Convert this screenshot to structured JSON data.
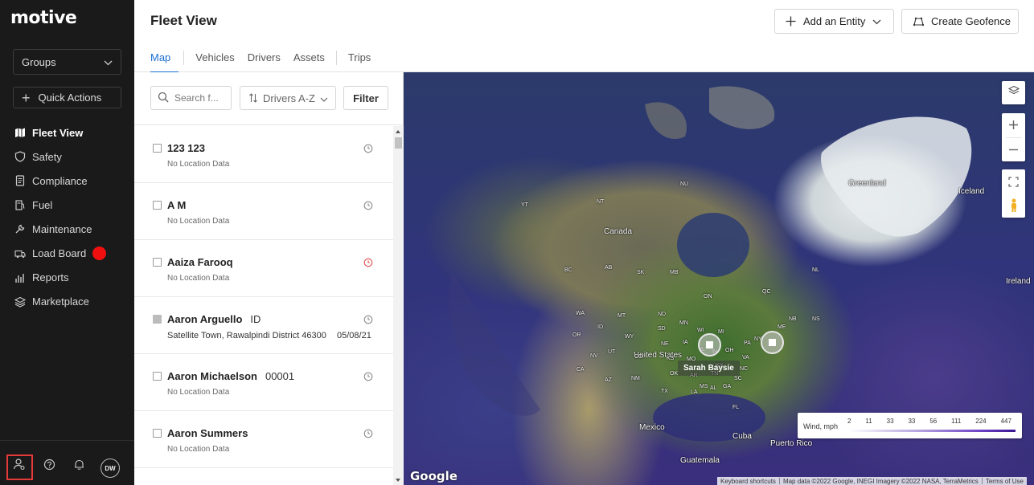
{
  "sidebar": {
    "logo": "motive",
    "groups_label": "Groups",
    "quick_actions_label": "Quick Actions",
    "items": [
      {
        "label": "Fleet View",
        "icon": "map-icon",
        "active": true
      },
      {
        "label": "Safety",
        "icon": "shield-icon"
      },
      {
        "label": "Compliance",
        "icon": "document-icon"
      },
      {
        "label": "Fuel",
        "icon": "fuel-pump-icon"
      },
      {
        "label": "Maintenance",
        "icon": "wrench-icon"
      },
      {
        "label": "Load Board",
        "icon": "truck-icon",
        "badge_color": "#f00f0f"
      },
      {
        "label": "Reports",
        "icon": "bar-chart-icon"
      },
      {
        "label": "Marketplace",
        "icon": "layers-icon"
      }
    ],
    "avatar_initials": "DW"
  },
  "header": {
    "title": "Fleet View",
    "add_entity_label": "Add an Entity",
    "create_geofence_label": "Create Geofence",
    "tabs": [
      {
        "label": "Map",
        "active": true
      },
      {
        "label": "Vehicles"
      },
      {
        "label": "Drivers"
      },
      {
        "label": "Assets"
      },
      {
        "label": "Trips"
      }
    ]
  },
  "list_panel": {
    "search_placeholder": "Search f...",
    "sort_label": "Drivers A-Z",
    "filter_label": "Filter",
    "rows": [
      {
        "name": "123 123",
        "tag": "",
        "location": "No Location Data",
        "date": "",
        "clock_color": "#8a8a8a"
      },
      {
        "name": "A M",
        "tag": "",
        "location": "No Location Data",
        "date": "",
        "clock_color": "#8a8a8a"
      },
      {
        "name": "Aaiza Farooq",
        "tag": "",
        "location": "No Location Data",
        "date": "",
        "clock_color": "#e05050"
      },
      {
        "name": "Aaron Arguello",
        "tag": "ID",
        "location": "Satellite Town, Rawalpindi District 46300",
        "date": "05/08/21",
        "clock_color": "#8a8a8a"
      },
      {
        "name": "Aaron Michaelson",
        "tag": "00001",
        "location": "No Location Data",
        "date": "",
        "clock_color": "#8a8a8a"
      },
      {
        "name": "Aaron Summers",
        "tag": "",
        "location": "No Location Data",
        "date": "",
        "clock_color": "#8a8a8a"
      }
    ]
  },
  "map": {
    "labels": {
      "greenland": "Greenland",
      "iceland": "Iceland",
      "ireland": "Ireland",
      "canada": "Canada",
      "united_states": "United States",
      "mexico": "Mexico",
      "cuba": "Cuba",
      "puerto_rico": "Puerto Rico",
      "guatemala": "Guatemala",
      "yt": "YT",
      "nt": "NT",
      "nu": "NU",
      "bc": "BC",
      "ab": "AB",
      "sk": "SK",
      "mb": "MB",
      "on": "ON",
      "qc": "QC",
      "nl": "NL",
      "nb": "NB",
      "ns": "NS",
      "me": "ME",
      "ny": "NY",
      "wa": "WA",
      "or": "OR",
      "ca": "CA",
      "nv": "NV",
      "id": "ID",
      "mt": "MT",
      "wy": "WY",
      "ut": "UT",
      "az": "AZ",
      "nm": "NM",
      "co": "CO",
      "nd": "ND",
      "sd": "SD",
      "ne": "NE",
      "ks": "KS",
      "ok": "OK",
      "tx": "TX",
      "mn": "MN",
      "ia": "IA",
      "mo": "MO",
      "ar": "AR",
      "la": "LA",
      "wi": "WI",
      "il": "IL",
      "in": "IN",
      "ky": "KY",
      "tn": "TN",
      "ms": "MS",
      "al": "AL",
      "ga": "GA",
      "fl": "FL",
      "sc": "SC",
      "nc": "NC",
      "va": "VA",
      "oh": "OH",
      "mi": "MI",
      "pa": "PA"
    },
    "marker_label": "Sarah Baysie",
    "legend": {
      "title": "Wind, mph",
      "values": [
        "2",
        "11",
        "33",
        "33",
        "56",
        "111",
        "224",
        "447"
      ]
    },
    "google_label": "Google",
    "attribution": {
      "keyboard": "Keyboard shortcuts",
      "data": "Map data ©2022 Google, INEGI Imagery ©2022 NASA, TerraMetrics",
      "terms": "Terms of Use"
    }
  }
}
